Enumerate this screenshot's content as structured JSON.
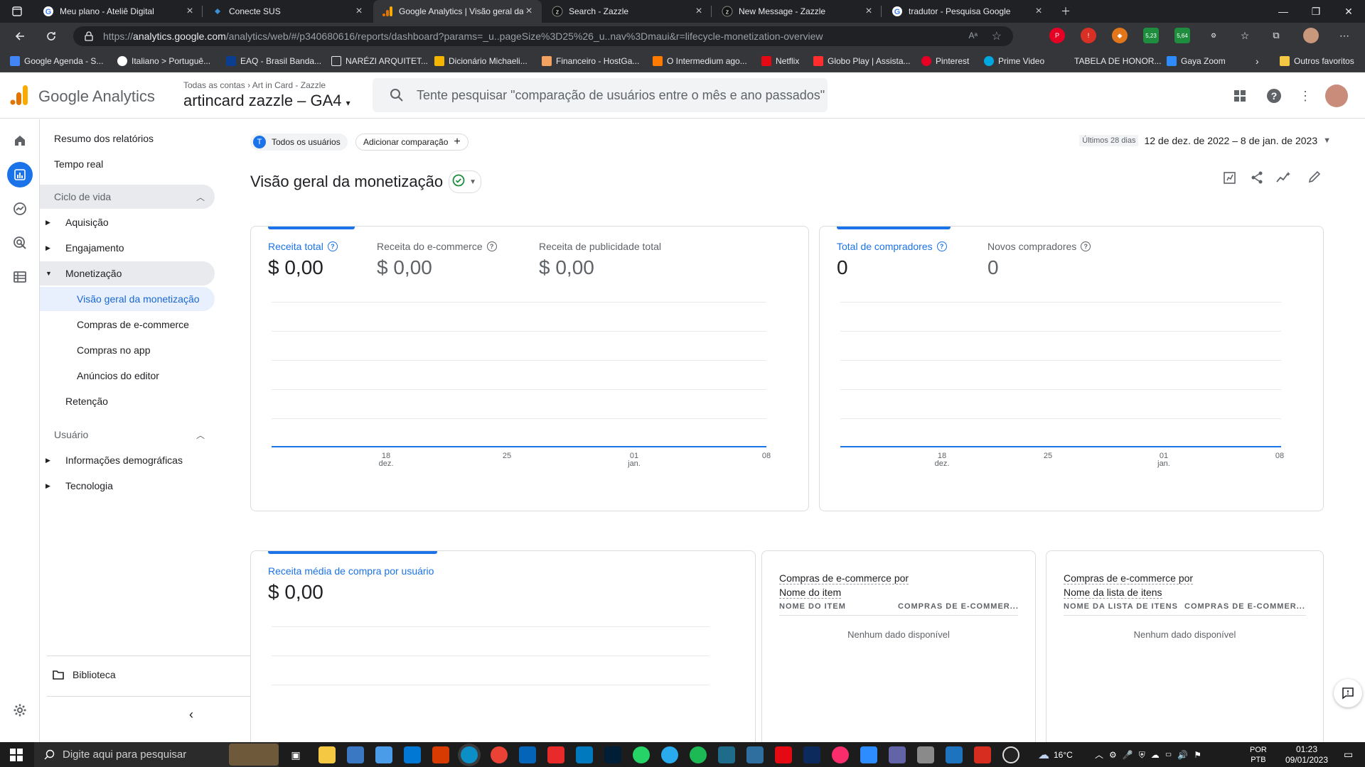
{
  "browser": {
    "tabs": [
      {
        "title": "Meu plano - Ateliê Digital",
        "favicon": "google-g-icon",
        "active": false
      },
      {
        "title": "Conecte SUS",
        "favicon": "conecte-sus-icon",
        "active": false
      },
      {
        "title": "Google Analytics | Visão geral da",
        "favicon": "google-analytics-icon",
        "active": true
      },
      {
        "title": "Search - Zazzle",
        "favicon": "zazzle-icon",
        "active": false
      },
      {
        "title": "New Message - Zazzle",
        "favicon": "zazzle-icon",
        "active": false
      },
      {
        "title": "tradutor - Pesquisa Google",
        "favicon": "google-g-icon",
        "active": false
      }
    ],
    "url_prefix": "https://",
    "url_host": "analytics.google.com",
    "url_path": "/analytics/web/#/p340680616/reports/dashboard?params=_u..pageSize%3D25%26_u..nav%3Dmaui&r=lifecycle-monetization-overview",
    "extension_badges": [
      "5,23",
      "5,64"
    ],
    "bookmarks": [
      {
        "label": "Google Agenda - S...",
        "icon": "calendar-icon",
        "color": "#4285f4"
      },
      {
        "label": "Italiano > Portuguê...",
        "icon": "translate-icon",
        "color": "#ffffff"
      },
      {
        "label": "EAQ - Brasil Banda...",
        "icon": "eaq-icon",
        "color": "#0b3d91"
      },
      {
        "label": "NARÉZI ARQUITET...",
        "icon": "document-icon",
        "color": "#e8eaed"
      },
      {
        "label": "Dicionário Michaeli...",
        "icon": "michaelis-icon",
        "color": "#f4b400"
      },
      {
        "label": "Financeiro - HostGa...",
        "icon": "hostgator-icon",
        "color": "#f4a261"
      },
      {
        "label": "O Intermedium ago...",
        "icon": "inter-icon",
        "color": "#ff7a00"
      },
      {
        "label": "Netflix",
        "icon": "netflix-icon",
        "color": "#e50914"
      },
      {
        "label": "Globo Play | Assista...",
        "icon": "globoplay-icon",
        "color": "#ff2d2d"
      },
      {
        "label": "Pinterest",
        "icon": "pinterest-icon",
        "color": "#e60023"
      },
      {
        "label": "Prime Video",
        "icon": "prime-video-icon",
        "color": "#00a8e1"
      },
      {
        "label": "TABELA DE HONOR...",
        "icon": "none",
        "color": "#35363a"
      },
      {
        "label": "Gaya Zoom",
        "icon": "zoom-icon",
        "color": "#2d8cff"
      }
    ],
    "other_favorites": "Outros favoritos"
  },
  "ga": {
    "product_name": "Google Analytics",
    "breadcrumb": "Todas as contas",
    "breadcrumb_account": "Art in Card - Zazzle",
    "property": "artincard zazzle – GA4",
    "search_placeholder": "Tente pesquisar \"comparação de usuários entre o mês e ano passados\""
  },
  "sidebar": {
    "top": [
      "Resumo dos relatórios",
      "Tempo real"
    ],
    "lifecycle_title": "Ciclo de vida",
    "lifecycle": [
      "Aquisição",
      "Engajamento",
      "Monetização"
    ],
    "monetization_children": [
      "Visão geral da monetização",
      "Compras de e-commerce",
      "Compras no app",
      "Anúncios do editor"
    ],
    "retention": "Retenção",
    "user_title": "Usuário",
    "user": [
      "Informações demográficas",
      "Tecnologia"
    ],
    "library": "Biblioteca"
  },
  "main": {
    "segment_avatar": "T",
    "segment": "Todos os usuários",
    "add_comparison": "Adicionar comparação",
    "date_hint": "Últimos 28 dias",
    "date_range": "12 de dez. de 2022 – 8 de jan. de 2023",
    "title": "Visão geral da monetização",
    "revenue_card": {
      "metrics": [
        {
          "label": "Receita total",
          "value": "$ 0,00"
        },
        {
          "label": "Receita do e-commerce",
          "value": "$ 0,00"
        },
        {
          "label": "Receita de publicidade total",
          "value": "$ 0,00"
        }
      ],
      "ticks": [
        {
          "top": "18",
          "bottom": "dez."
        },
        {
          "top": "25",
          "bottom": ""
        },
        {
          "top": "01",
          "bottom": "jan."
        },
        {
          "top": "08",
          "bottom": ""
        }
      ]
    },
    "buyers_card": {
      "metrics": [
        {
          "label": "Total de compradores",
          "value": "0"
        },
        {
          "label": "Novos compradores",
          "value": "0"
        }
      ],
      "ticks": [
        {
          "top": "18",
          "bottom": "dez."
        },
        {
          "top": "25",
          "bottom": ""
        },
        {
          "top": "01",
          "bottom": "jan."
        },
        {
          "top": "08",
          "bottom": ""
        }
      ]
    },
    "avg_card": {
      "label": "Receita média de compra por usuário",
      "value": "$ 0,00"
    },
    "items_card": {
      "title_line1": "Compras de e-commerce por",
      "title_line2": "Nome do item",
      "col1": "NOME DO ITEM",
      "col2": "COMPRAS DE E-COMMER...",
      "empty": "Nenhum dado disponível"
    },
    "lists_card": {
      "title_line1": "Compras de e-commerce por",
      "title_line2": "Nome da lista de itens",
      "col1": "NOME DA LISTA DE ITENS",
      "col2": "COMPRAS DE E-COMMER...",
      "empty": "Nenhum dado disponível"
    }
  },
  "taskbar": {
    "search_placeholder": "Digite aqui para pesquisar",
    "weather": "16°C",
    "lang1": "POR",
    "lang2": "PTB",
    "time": "01:23",
    "date": "09/01/2023"
  },
  "colors": {
    "accent": "#1a73e8",
    "ga_orange": "#f9ab00",
    "ga_dark_orange": "#e37400"
  }
}
